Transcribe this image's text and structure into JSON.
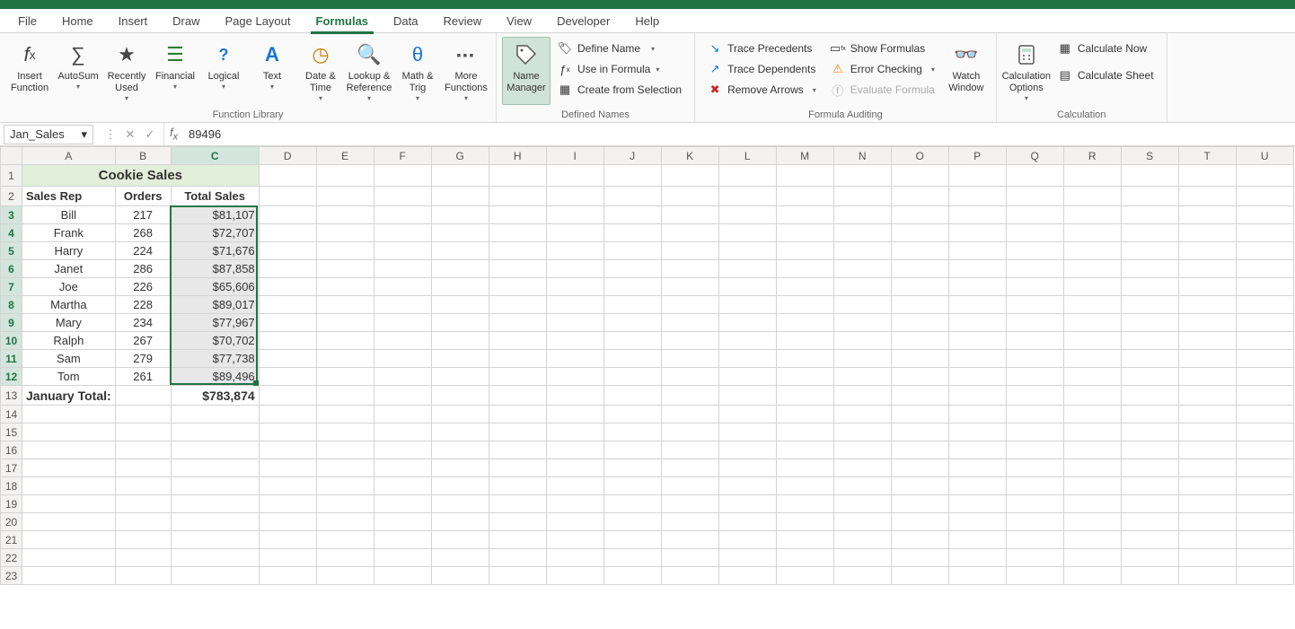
{
  "tabs": [
    "File",
    "Home",
    "Insert",
    "Draw",
    "Page Layout",
    "Formulas",
    "Data",
    "Review",
    "View",
    "Developer",
    "Help"
  ],
  "active_tab": "Formulas",
  "ribbon": {
    "function_library": {
      "label": "Function Library",
      "insert_function": "Insert\nFunction",
      "autosum": "AutoSum",
      "recently_used": "Recently\nUsed",
      "financial": "Financial",
      "logical": "Logical",
      "text": "Text",
      "date_time": "Date &\nTime",
      "lookup_ref": "Lookup &\nReference",
      "math_trig": "Math &\nTrig",
      "more_functions": "More\nFunctions"
    },
    "defined_names": {
      "label": "Defined Names",
      "name_manager": "Name\nManager",
      "define_name": "Define Name",
      "use_in_formula": "Use in Formula",
      "create_from_selection": "Create from Selection"
    },
    "formula_auditing": {
      "label": "Formula Auditing",
      "trace_precedents": "Trace Precedents",
      "trace_dependents": "Trace Dependents",
      "remove_arrows": "Remove Arrows",
      "show_formulas": "Show Formulas",
      "error_checking": "Error Checking",
      "evaluate_formula": "Evaluate Formula",
      "watch_window": "Watch\nWindow"
    },
    "calculation": {
      "label": "Calculation",
      "calculation_options": "Calculation\nOptions",
      "calculate_now": "Calculate Now",
      "calculate_sheet": "Calculate Sheet"
    }
  },
  "namebox": "Jan_Sales",
  "formula_value": "89496",
  "columns": [
    "A",
    "B",
    "C",
    "D",
    "E",
    "F",
    "G",
    "H",
    "I",
    "J",
    "K",
    "L",
    "M",
    "N",
    "O",
    "P",
    "Q",
    "R",
    "S",
    "T",
    "U"
  ],
  "title_cell": "Cookie Sales",
  "headers": {
    "a": "Sales Rep",
    "b": "Orders",
    "c": "Total Sales"
  },
  "rows": [
    {
      "rep": "Bill",
      "orders": "217",
      "sales": "$81,107"
    },
    {
      "rep": "Frank",
      "orders": "268",
      "sales": "$72,707"
    },
    {
      "rep": "Harry",
      "orders": "224",
      "sales": "$71,676"
    },
    {
      "rep": "Janet",
      "orders": "286",
      "sales": "$87,858"
    },
    {
      "rep": "Joe",
      "orders": "226",
      "sales": "$65,606"
    },
    {
      "rep": "Martha",
      "orders": "228",
      "sales": "$89,017"
    },
    {
      "rep": "Mary",
      "orders": "234",
      "sales": "$77,967"
    },
    {
      "rep": "Ralph",
      "orders": "267",
      "sales": "$70,702"
    },
    {
      "rep": "Sam",
      "orders": "279",
      "sales": "$77,738"
    },
    {
      "rep": "Tom",
      "orders": "261",
      "sales": "$89,496"
    }
  ],
  "total_label": "January Total:",
  "total_value": "$783,874"
}
